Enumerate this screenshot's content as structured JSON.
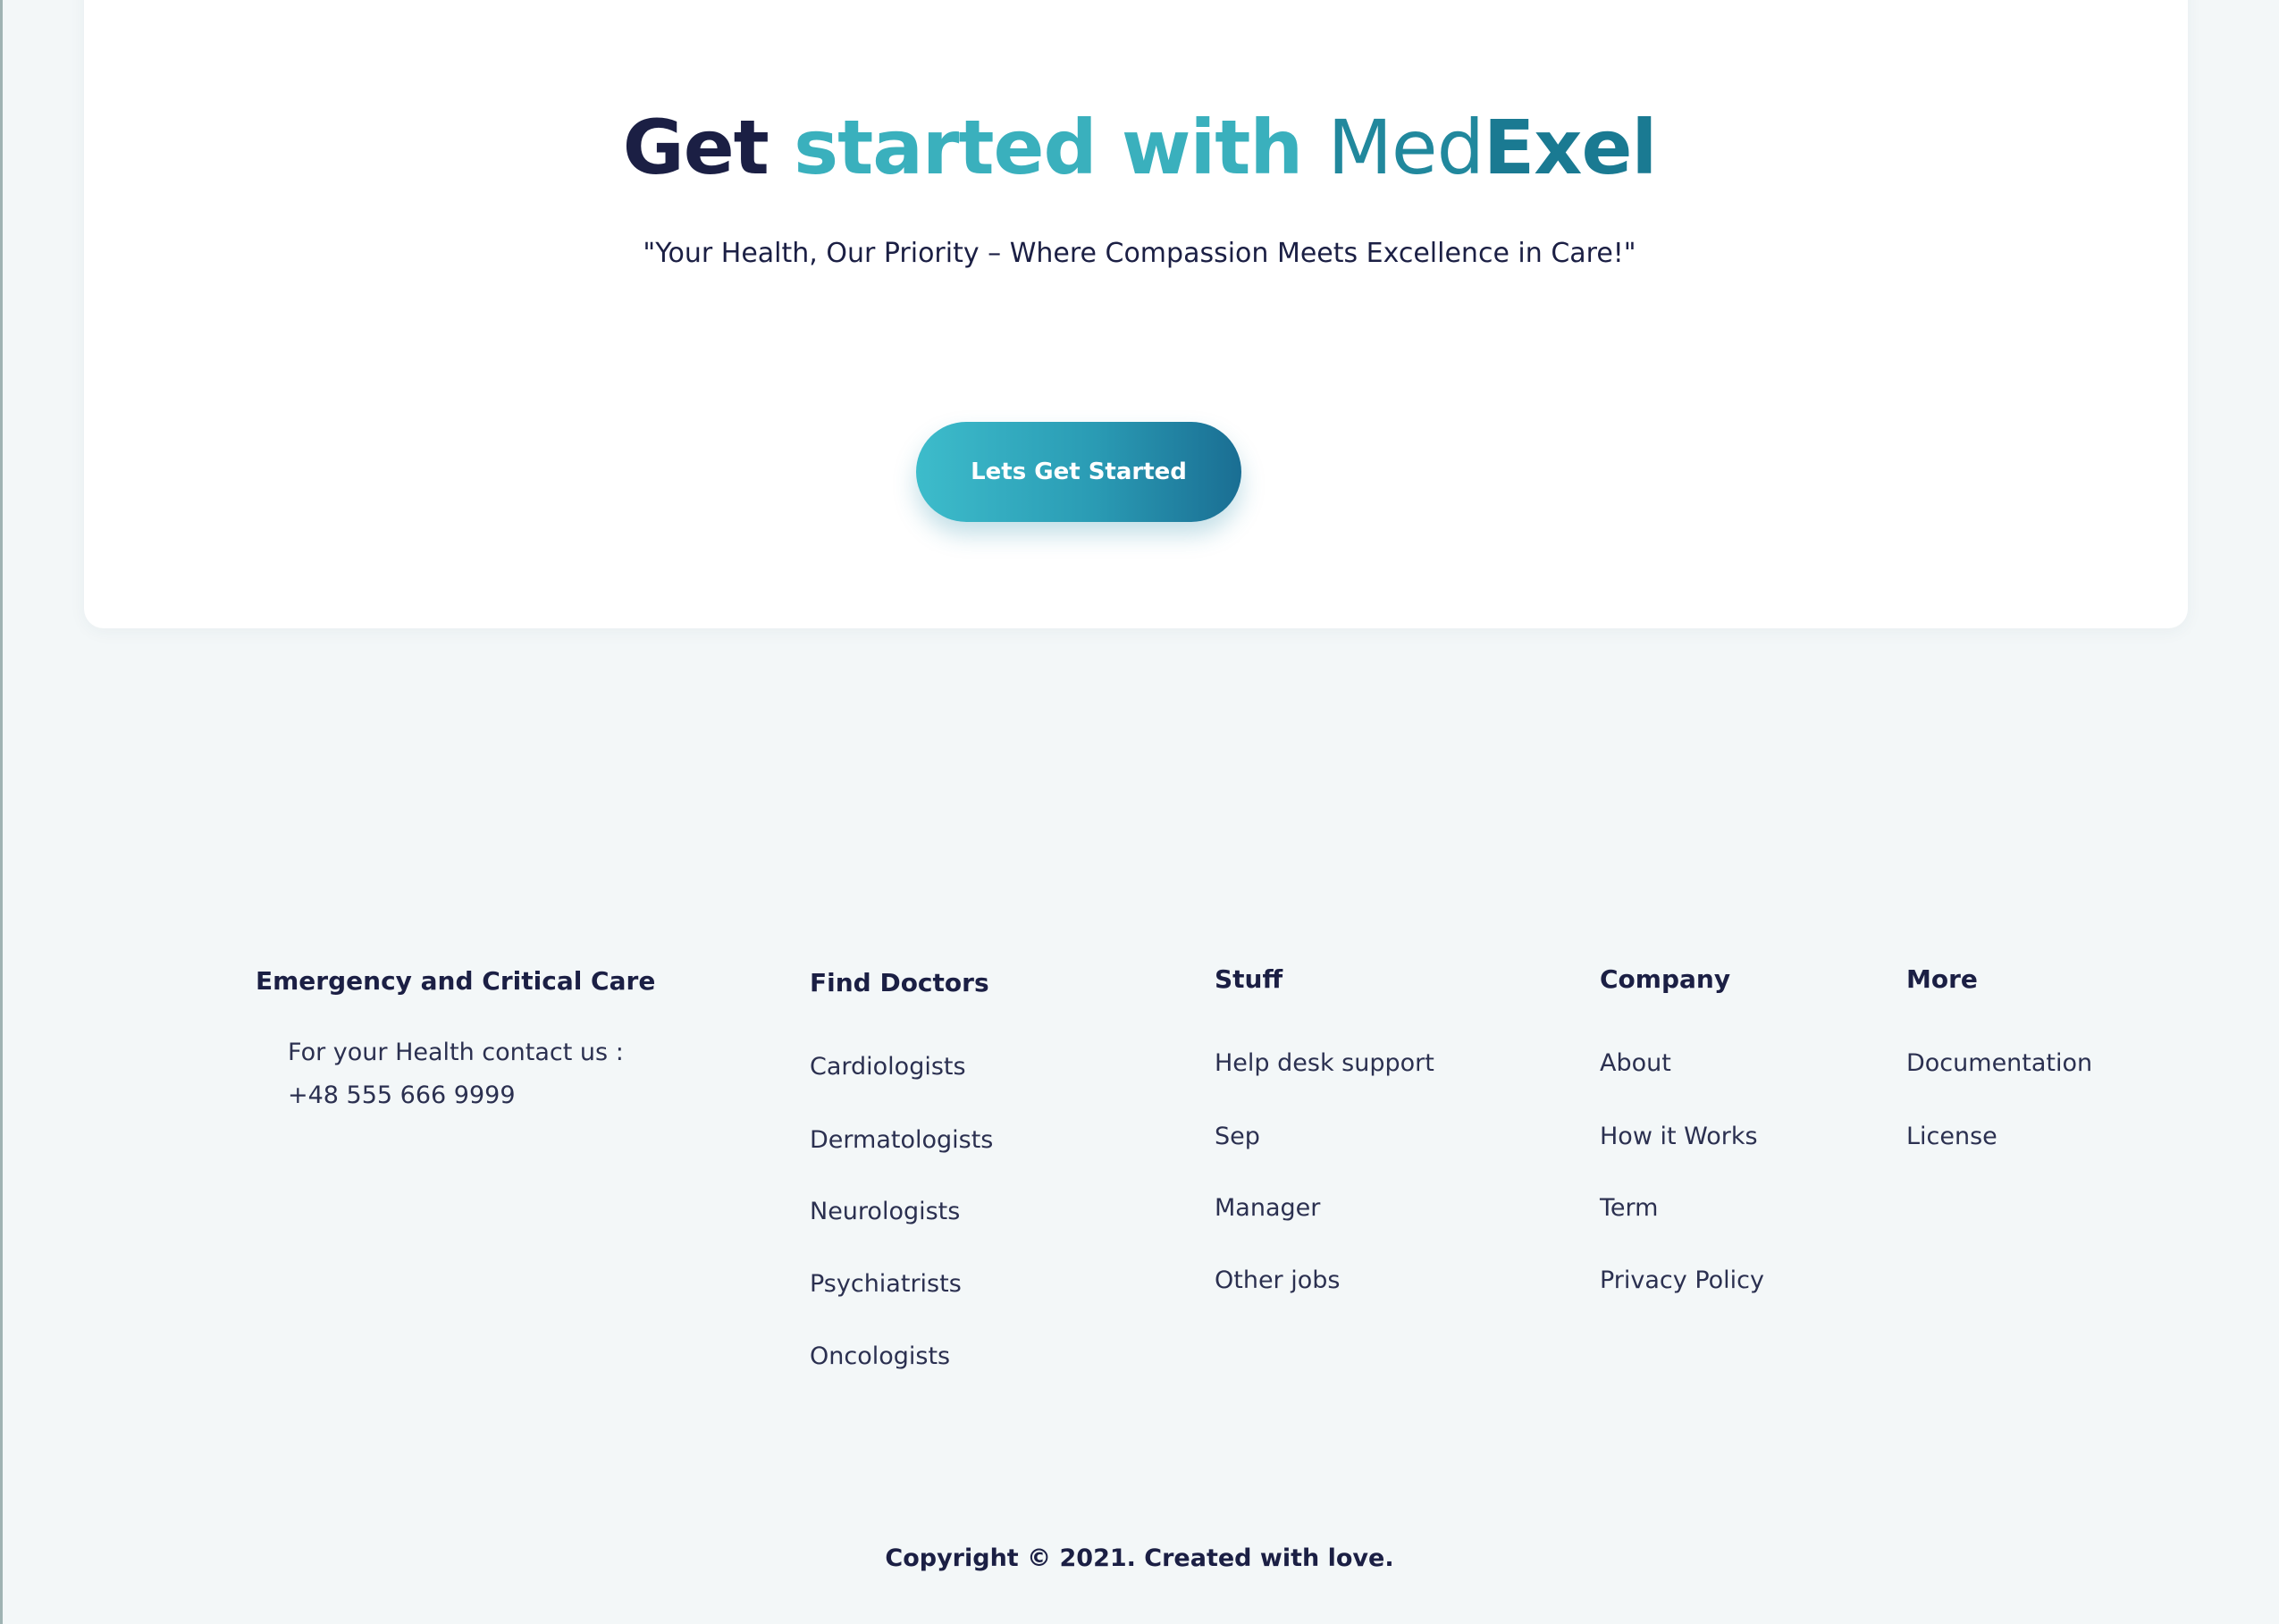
{
  "cta": {
    "heading_get": "Get",
    "heading_started": "started with",
    "heading_med": "Med",
    "heading_exel": "Exel",
    "tagline": "\"Your Health, Our Priority – Where Compassion Meets Excellence in Care!\"",
    "button_label": "Lets Get Started"
  },
  "footer": {
    "emergency": {
      "title": "Emergency and Critical Care",
      "contact_line": "For your Health contact us :",
      "phone": "+48 555 666 9999"
    },
    "find_doctors": {
      "title": "Find Doctors",
      "links": [
        "Cardiologists",
        "Dermatologists",
        "Neurologists",
        "Psychiatrists",
        "Oncologists"
      ]
    },
    "stuff": {
      "title": "Stuff",
      "links": [
        "Help desk support",
        "Sep",
        "Manager",
        "Other jobs"
      ]
    },
    "company": {
      "title": "Company",
      "links": [
        "About",
        "How it Works",
        "Term",
        "Privacy Policy"
      ]
    },
    "more": {
      "title": "More",
      "links": [
        "Documentation",
        "License"
      ]
    },
    "copyright": "Copyright © 2021. Created with love."
  },
  "colors": {
    "page_background": "#f3f7f8",
    "card_background": "#ffffff",
    "dark_navy": "#1b1f44",
    "accent_teal": "#3ab0bd",
    "accent_dark_teal": "#1a7a92"
  }
}
